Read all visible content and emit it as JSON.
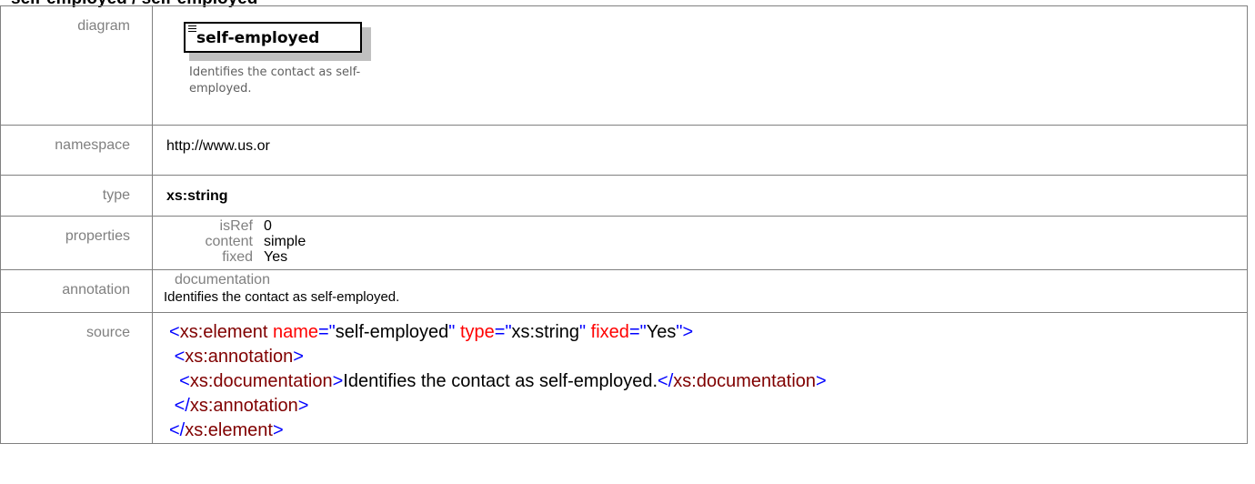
{
  "heading": "self-employed / self-employed",
  "rows": {
    "diagram": {
      "label": "diagram",
      "element_name": "self-employed",
      "element_description": "Identifies the contact as self-employed."
    },
    "namespace": {
      "label": "namespace",
      "value": "http://www.us.or"
    },
    "type": {
      "label": "type",
      "value": "xs:string"
    },
    "properties": {
      "label": "properties",
      "items": [
        {
          "key": "isRef",
          "value": "0"
        },
        {
          "key": "content",
          "value": "simple"
        },
        {
          "key": "fixed",
          "value": "Yes"
        }
      ]
    },
    "annotation": {
      "label": "annotation",
      "heading": "documentation",
      "text": "Identifies the contact as self-employed."
    },
    "source": {
      "label": "source",
      "lines": [
        [
          "<",
          "xs:element",
          " name",
          "=\"",
          "self-employed",
          "\"",
          " type",
          "=\"",
          "xs:string",
          "\"",
          " fixed",
          "=\"",
          "Yes",
          "\">"
        ],
        [
          "<",
          "xs:annotation",
          ">"
        ],
        [
          "<",
          "xs:documentation",
          ">",
          "Identifies the contact as self-employed.",
          "</",
          "xs:documentation",
          ">"
        ],
        [
          "</",
          "xs:annotation",
          ">"
        ],
        [
          "</",
          "xs:element",
          ">"
        ]
      ]
    }
  },
  "colors": {
    "tag": "#0000ff",
    "element_name": "#800000",
    "attr_name": "#ff0000",
    "label": "#808080",
    "border": "#808080"
  }
}
